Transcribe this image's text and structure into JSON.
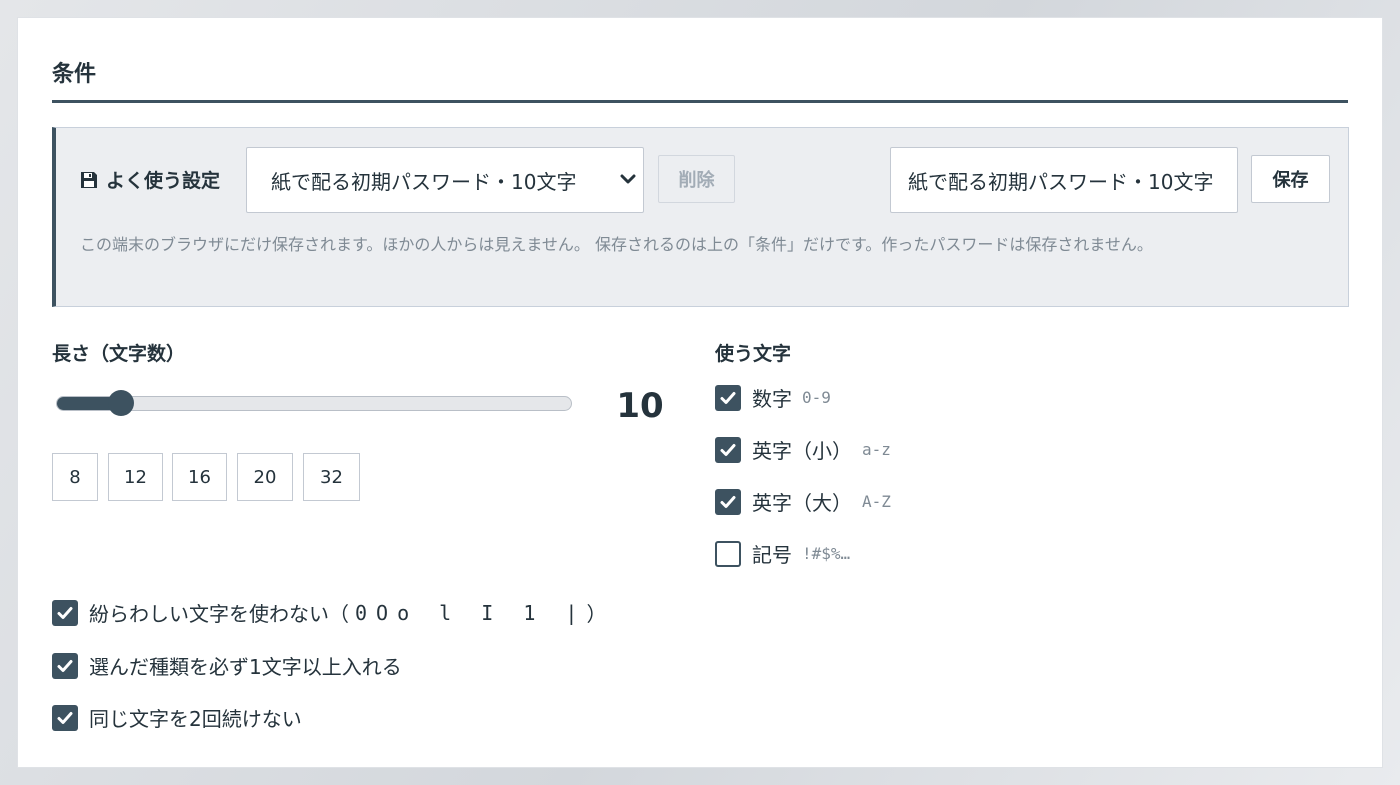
{
  "heading": "条件",
  "presets": {
    "label": "よく使う設定",
    "icon": "floppy-disk-icon",
    "selected": "紙で配る初期パスワード・10文字",
    "delete_label": "削除",
    "name_value": "紙で配る初期パスワード・10文字",
    "save_label": "保存",
    "note": "この端末のブラウザにだけ保存されます。ほかの人からは見えません。 保存されるのは上の「条件」だけです。作ったパスワードは保存されません。"
  },
  "length": {
    "label": "長さ（文字数）",
    "value": 10,
    "display": "10",
    "min": 8,
    "max": 64,
    "slider_fraction": 0.125,
    "presets": [
      "8",
      "12",
      "16",
      "20",
      "32"
    ]
  },
  "charsets": {
    "label": "使う文字",
    "items": [
      {
        "label": "数字",
        "hint": "0-9",
        "checked": true
      },
      {
        "label": "英字（小）",
        "hint": "a-z",
        "checked": true
      },
      {
        "label": "英字（大）",
        "hint": "A-Z",
        "checked": true
      },
      {
        "label": "記号",
        "hint": "!#$%…",
        "checked": false
      }
    ]
  },
  "options": [
    {
      "label": "紛らわしい文字を使わない（",
      "chars": "0Oo l I 1 |",
      "suffix": "）",
      "checked": true
    },
    {
      "label": "選んだ種類を必ず1文字以上入れる",
      "checked": true
    },
    {
      "label": "同じ文字を2回続けない",
      "checked": true
    }
  ],
  "colors": {
    "accent": "#3d5260",
    "text": "#25333c",
    "muted": "#7f8a94",
    "panel": "#eceef1"
  }
}
